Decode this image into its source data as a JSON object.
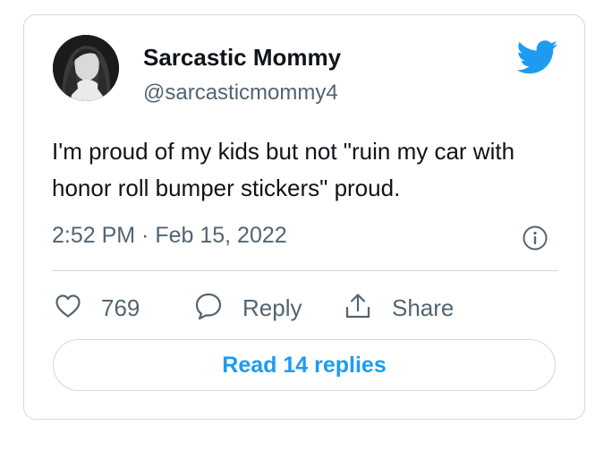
{
  "tweet": {
    "author": {
      "display_name": "Sarcastic Mommy",
      "handle": "@sarcasticmommy4",
      "avatar_icon": "avatar-photo"
    },
    "text": "I'm proud of my kids but not \"ruin my car with honor roll bumper stickers\" proud.",
    "timestamp": "2:52 PM · Feb 15, 2022",
    "brand_icon": "twitter-bird-icon",
    "brand_color": "#1d9bf0"
  },
  "actions": {
    "like": {
      "count": "769",
      "icon": "heart-icon"
    },
    "reply": {
      "label": "Reply",
      "icon": "speech-bubble-icon"
    },
    "share": {
      "label": "Share",
      "icon": "share-arrow-icon"
    }
  },
  "read_replies_label": "Read 14 replies",
  "colors": {
    "text": "#0f1419",
    "secondary": "#536471",
    "border": "#cfd9de",
    "accent": "#1d9bf0"
  }
}
